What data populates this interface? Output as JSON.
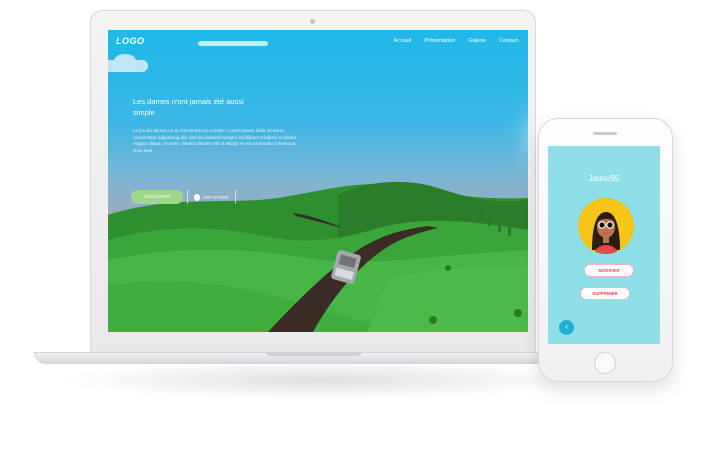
{
  "site": {
    "logo": "LOGO",
    "nav": [
      "Accueil",
      "Présentation",
      "Galerie",
      "Contact"
    ],
    "hero_title": "Les dames n'ont jamais été aussi simple",
    "hero_body": "Le jeu de dames ou tu réinventes ton monde ! Lorem ipsum dolor sit amet, consectetur adipisicing elit, sed do eiusmod tempor incididunt ut labore et dolore magna aliqua. Ut enim ullamco laboris nisi ut aliquip ex ea commodo consequat. Duis aute",
    "discover_label": "DÉCOUVRIR",
    "store_label": "APP STORE"
  },
  "phone": {
    "username": "Jadou95",
    "modify_label": "MODIFIER",
    "delete_label": "SUPPRIMER",
    "back_icon": "chevron-left-icon"
  },
  "colors": {
    "sky": "#1fb8e8",
    "grass": "#3fae3f",
    "road": "#3a2b25",
    "button_green": "#9ed98a",
    "phone_bg": "#8fdfe8",
    "accent_red": "#ef4a5a"
  }
}
